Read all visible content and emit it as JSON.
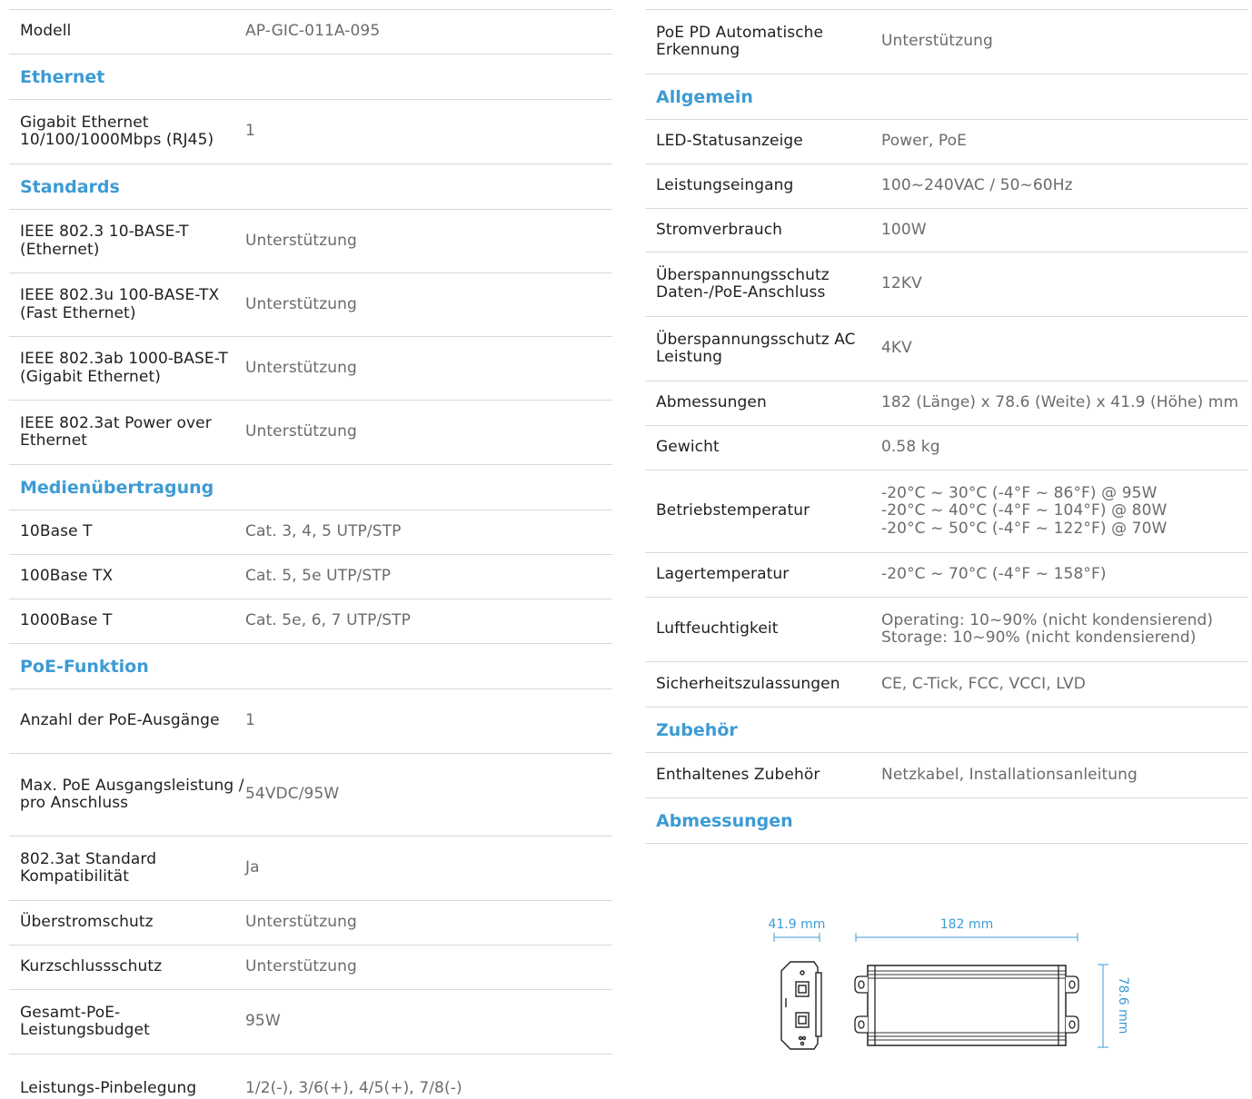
{
  "left": {
    "modell": {
      "label": "Modell",
      "value": "AP-GIC-011A-095"
    },
    "sec_ethernet": "Ethernet",
    "gigabit": {
      "label": "Gigabit Ethernet 10/100/1000Mbps (RJ45)",
      "value": "1"
    },
    "sec_standards": "Standards",
    "std_rows": [
      {
        "label": "IEEE 802.3 10-BASE-T (Ethernet)",
        "value": "Unterstützung"
      },
      {
        "label": "IEEE 802.3u 100-BASE-TX (Fast Ethernet)",
        "value": "Unterstützung"
      },
      {
        "label": "IEEE 802.3ab 1000-BASE-T (Gigabit Ethernet)",
        "value": "Unterstützung"
      },
      {
        "label": "IEEE 802.3at Power over Ethernet",
        "value": "Unterstützung"
      }
    ],
    "sec_medien": "Medienübertragung",
    "medien_rows": [
      {
        "label": "10Base T",
        "value": "Cat. 3, 4, 5 UTP/STP"
      },
      {
        "label": "100Base TX",
        "value": "Cat. 5, 5e UTP/STP"
      },
      {
        "label": "1000Base T",
        "value": "Cat. 5e, 6, 7 UTP/STP"
      }
    ],
    "sec_poe": "PoE-Funktion",
    "poe_rows": [
      {
        "label": "Anzahl der PoE-Ausgänge",
        "value": "1"
      },
      {
        "label": "Max. PoE Ausgangsleistung / pro Anschluss",
        "value": "54VDC/95W"
      },
      {
        "label": "802.3at Standard Kompatibilität",
        "value": "Ja"
      },
      {
        "label": "Überstromschutz",
        "value": "Unterstützung"
      },
      {
        "label": "Kurzschlussschutz",
        "value": "Unterstützung"
      },
      {
        "label": "Gesamt-PoE-Leistungsbudget",
        "value": "95W"
      },
      {
        "label": "Leistungs-Pinbelegung",
        "value": "1/2(-), 3/6(+), 4/5(+), 7/8(-)"
      }
    ]
  },
  "right": {
    "poe_pd": {
      "label": "PoE PD Automatische Erkennung",
      "value": "Unterstützung"
    },
    "sec_allgemein": "Allgemein",
    "allg_rows": [
      {
        "label": "LED-Statusanzeige",
        "value": "Power, PoE"
      },
      {
        "label": "Leistungseingang",
        "value": "100~240VAC / 50~60Hz"
      },
      {
        "label": "Stromverbrauch",
        "value": "100W"
      },
      {
        "label": "Überspannungsschutz Daten-/PoE-Anschluss",
        "value": "12KV"
      },
      {
        "label": "Überspannungsschutz AC Leistung",
        "value": "4KV"
      },
      {
        "label": "Abmessungen",
        "value": "182 (Länge) x 78.6 (Weite) x 41.9 (Höhe) mm"
      },
      {
        "label": "Gewicht",
        "value": "0.58 kg"
      },
      {
        "label": "Betriebstemperatur",
        "value": "-20°C ~ 30°C (-4°F ~ 86°F) @ 95W\n-20°C ~ 40°C (-4°F ~ 104°F) @ 80W\n-20°C ~ 50°C (-4°F ~ 122°F) @ 70W"
      },
      {
        "label": "Lagertemperatur",
        "value": "-20°C ~ 70°C (-4°F ~ 158°F)"
      },
      {
        "label": "Luftfeuchtigkeit",
        "value": "Operating: 10~90% (nicht kondensierend)\nStorage: 10~90% (nicht kondensierend)"
      },
      {
        "label": "Sicherheitszulassungen",
        "value": "CE, C-Tick, FCC, VCCI, LVD"
      }
    ],
    "sec_zubehoer": "Zubehör",
    "zubehoer": {
      "label": "Enthaltenes Zubehör",
      "value": "Netzkabel, Installationsanleitung"
    },
    "sec_abmessungen": "Abmessungen",
    "dims": {
      "height": "41.9 mm",
      "length": "182 mm",
      "width": "78.6 mm"
    }
  },
  "colors": {
    "accent": "#3d9bd4",
    "rule": "#d9d9d9",
    "value_text": "#6b6b6b"
  }
}
